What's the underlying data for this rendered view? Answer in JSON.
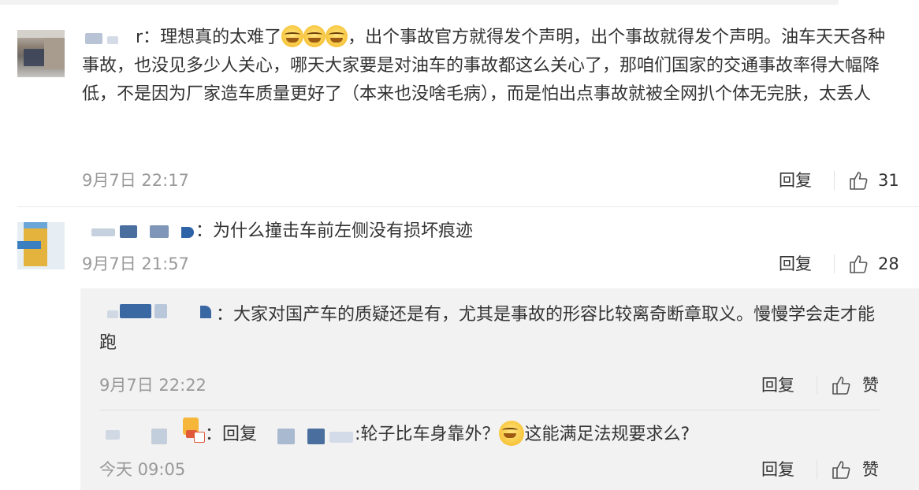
{
  "comments": [
    {
      "username": "r",
      "text_before_emoji": "理想真的太难了",
      "emojis": [
        "crying-laughing-icon",
        "crying-laughing-icon",
        "crying-laughing-icon"
      ],
      "text_after_emoji": "，出个事故官方就得发个声明，出个事故就得发个声明。油车天天各种事故，也没见多少人关心，哪天大家要是对油车的事故都这么关心了，那咱们国家的交通事故率得大幅降低，不是因为厂家造车质量更好了（本来也没啥毛病），而是怕出点事故就被全网扒个体无完肤，太丢人",
      "time": "9月7日 22:17",
      "reply_label": "回复",
      "likes": "31"
    },
    {
      "username": "",
      "text": "为什么撞击车前左侧没有损坏痕迹",
      "time": "9月7日 21:57",
      "reply_label": "回复",
      "likes": "28",
      "replies": [
        {
          "text": "大家对国产车的质疑还是有，尤其是事故的形容比较离奇断章取义。慢慢学会走才能跑",
          "time": "9月7日 22:22",
          "reply_label": "回复",
          "like_label": "赞"
        },
        {
          "reply_prefix": "回复",
          "text_before_emoji": ":轮子比车身靠外？",
          "emoji": "thinking-icon",
          "text_after_emoji": "这能满足法规要求么?",
          "time": "今天 09:05",
          "reply_label": "回复",
          "like_label": "赞"
        }
      ]
    }
  ],
  "colors": {
    "meta": "#999999",
    "text": "#333333",
    "reply_bg": "#f2f2f2",
    "divider": "#eaeaea"
  }
}
